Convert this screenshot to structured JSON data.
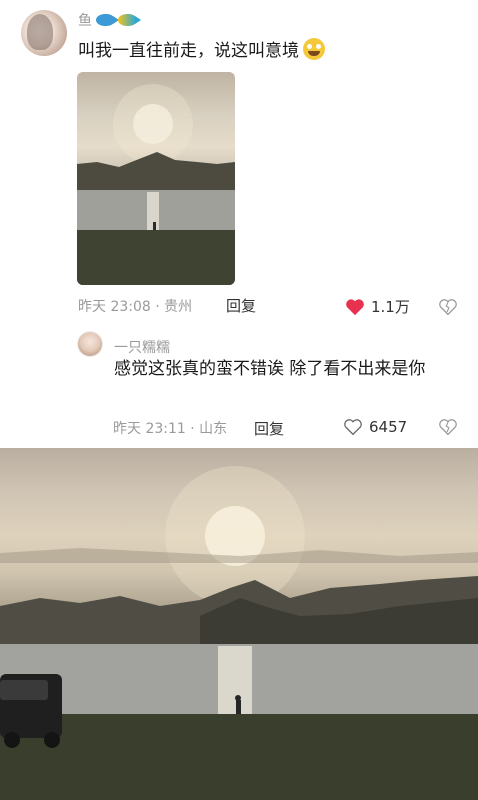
{
  "post": {
    "username": "鱼",
    "text": "叫我一直往前走，说这叫意境",
    "timestamp": "昨天 23:08 · 贵州",
    "reply_label": "回复",
    "like_count": "1.1万",
    "icons": {
      "username_badges": [
        "fish-blue-icon",
        "fish-yellow-icon"
      ],
      "emoji": "grinning-emoji-icon",
      "like": "heart-filled-icon",
      "dislike": "broken-heart-icon"
    },
    "colors": {
      "like_active": "#e8314f"
    }
  },
  "reply": {
    "username": "一只糯糯",
    "text": "感觉这张真的蛮不错诶 除了看不出来是你",
    "timestamp": "昨天 23:11 · 山东",
    "reply_label": "回复",
    "like_count": "6457",
    "icons": {
      "like": "heart-outline-icon",
      "dislike": "broken-heart-icon"
    }
  }
}
